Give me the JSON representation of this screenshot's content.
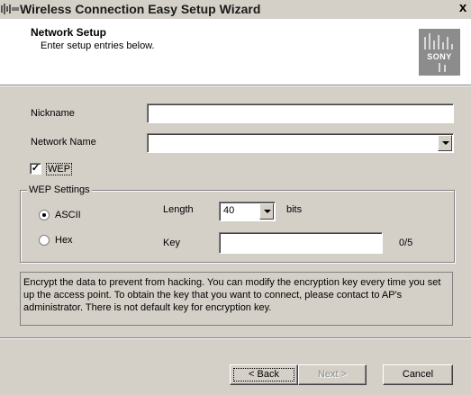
{
  "window": {
    "title": "Wireless Connection Easy Setup Wizard",
    "close_glyph": "x"
  },
  "header": {
    "title": "Network Setup",
    "subtitle": "Enter setup entries below.",
    "logo_text": "SONY"
  },
  "form": {
    "nickname": {
      "label": "Nickname",
      "value": ""
    },
    "network_name": {
      "label": "Network Name",
      "value": ""
    },
    "wep": {
      "label": "WEP",
      "checked": true
    },
    "wep_settings": {
      "title": "WEP Settings",
      "ascii_label": "ASCII",
      "hex_label": "Hex",
      "selected_mode": "ASCII",
      "length_label": "Length",
      "length_value": "40",
      "length_unit": "bits",
      "key_label": "Key",
      "key_value": "",
      "key_counter": "0/5"
    }
  },
  "description": "Encrypt the data to prevent from hacking. You can modify the encryption key every time you set up the access point. To obtain the key that you want to connect, please contact to AP's administrator. There is not default key for encryption key.",
  "buttons": {
    "back": "< Back",
    "next": "Next >",
    "cancel": "Cancel"
  }
}
